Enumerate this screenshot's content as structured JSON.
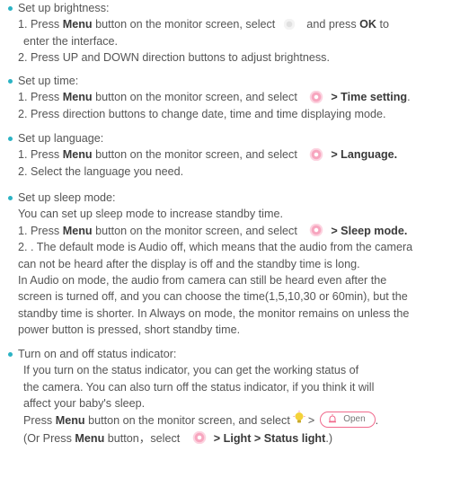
{
  "sections": {
    "brightness": {
      "title": "Set up brightness:",
      "s1_pre": "1. Press ",
      "s1_menu": "Menu",
      "s1_mid": " button on the monitor screen, select ",
      "s1_post": " and press ",
      "s1_ok": "OK",
      "s1_end": " to",
      "s1_cont": "enter the interface.",
      "s2": "2. Press UP and DOWN direction buttons to adjust brightness."
    },
    "time": {
      "title": "Set up time:",
      "s1_pre": "1. Press ",
      "s1_menu": "Menu",
      "s1_mid": " button on the monitor screen, and select ",
      "s1_target": "> Time setting",
      "s1_end": ".",
      "s2": "2. Press direction buttons to change date, time and time displaying mode."
    },
    "language": {
      "title": "Set up language:",
      "s1_pre": "1. Press ",
      "s1_menu": "Menu",
      "s1_mid": " button on the monitor screen, and select ",
      "s1_target": "> Language.",
      "s2": "2. Select the language you need."
    },
    "sleep": {
      "title": "Set up sleep mode:",
      "intro": "You can set up sleep mode to increase standby time.",
      "s1_pre": "1. Press ",
      "s1_menu": "Menu",
      "s1_mid": " button on the monitor screen, and select ",
      "s1_target": "> Sleep mode.",
      "p1": "2. . The default mode is Audio off, which means that the audio from the camera",
      "p2": "can not be heard after the display is off and the standby time is long.",
      "p3": "In Audio on mode, the audio from camera can still be heard even after the",
      "p4": "screen is turned off, and you can choose the time(1,5,10,30 or 60min), but the",
      "p5": "standby time is shorter. In Always on mode, the monitor remains on unless the",
      "p6": "power button is pressed, short standby time."
    },
    "status": {
      "title": "Turn on and off status indicator:",
      "p1": "If you turn on the status indicator, you can get the working status of",
      "p2": "the camera. You can also turn off the status indicator, if you think it will",
      "p3": "affect your baby's sleep.",
      "l4_pre": "Press ",
      "l4_menu": "Menu",
      "l4_mid": " button on the monitor screen, and select",
      "l4_gt": ">",
      "open_label": "Open",
      "l4_end": ".",
      "l5_pre": "(Or Press ",
      "l5_menu": "Menu",
      "l5_mid": " button，select ",
      "l5_target": "> Light > Status light",
      "l5_end": ".)"
    }
  },
  "icons": {
    "brightness": "sun-icon",
    "settings": "gear-icon",
    "light": "bulb-icon",
    "alarm": "alarm-light-icon"
  },
  "colors": {
    "bullet": "#2bb3c4",
    "accent_pink": "#f06a8c",
    "text": "#555555"
  }
}
